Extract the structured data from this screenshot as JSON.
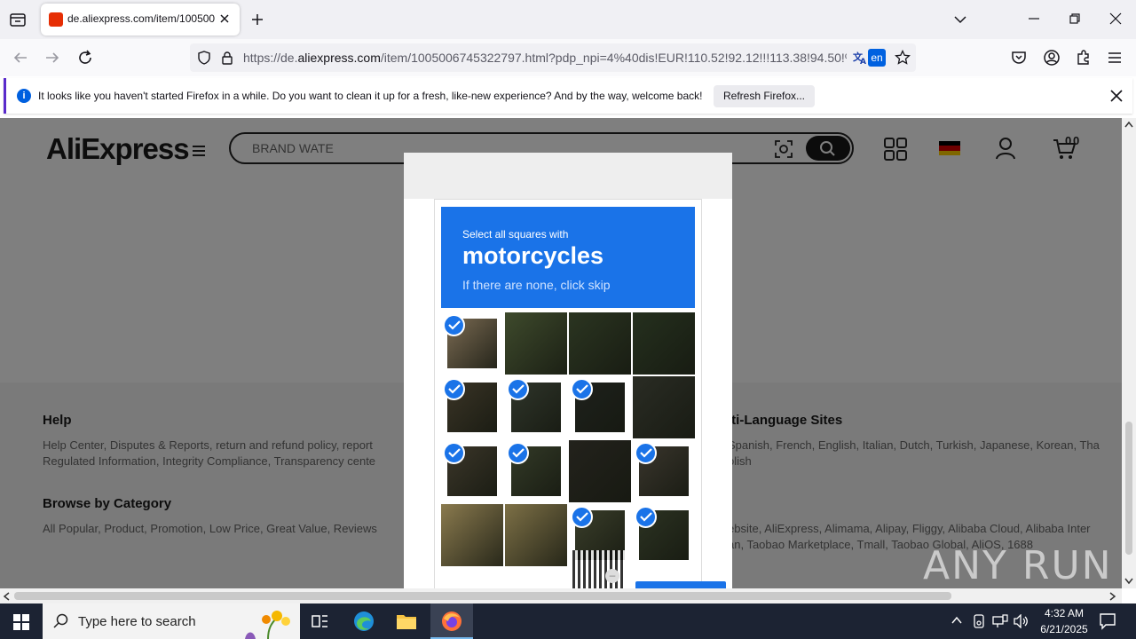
{
  "browser": {
    "tab_title": "de.aliexpress.com/item/100500",
    "url_prefix": "https://de.",
    "url_domain": "aliexpress.com",
    "url_rest": "/item/1005006745322797.html?pdp_npi=4%40dis!EUR!110.52!92.12!!!113.38!94.50!%4",
    "translate_badge": "en"
  },
  "notification": {
    "message": "It looks like you haven't started Firefox in a while. Do you want to clean it up for a fresh, like-new experience? And by the way, welcome back!",
    "button": "Refresh Firefox..."
  },
  "site": {
    "logo": "AliExpress",
    "search_value": "BRAND WATE",
    "cart_count": "0"
  },
  "footer": {
    "help_title": "Help",
    "help_line1": "Help Center, Disputes & Reports, return and refund policy, report",
    "help_line2": "Regulated Information, Integrity Compliance, Transparency cente",
    "multi_title": "lti-Language Sites",
    "multi_line1": "Spanish, French, English, Italian, Dutch, Turkish, Japanese, Korean, Tha",
    "multi_line2": "olish",
    "browse_title": "Browse by Category",
    "browse_line1": "All Popular, Product, Promotion, Low Price, Great Value, Reviews",
    "group_line1": "ebsite, AliExpress, Alimama, Alipay, Fliggy, Alibaba Cloud, Alibaba Inter",
    "group_line2": "an, Taobao Marketplace, Tmall, Taobao Global, AliOS, 1688"
  },
  "captcha": {
    "line1": "Select all squares with",
    "line2": "motorcycles",
    "line3": "If there are none, click skip",
    "tiles": [
      {
        "checked": true,
        "color": "#7a6a52"
      },
      {
        "checked": false,
        "color": "#3e4a2c"
      },
      {
        "checked": false,
        "color": "#2b3521"
      },
      {
        "checked": false,
        "color": "#25301e"
      },
      {
        "checked": true,
        "color": "#3a3426"
      },
      {
        "checked": true,
        "color": "#2f352a"
      },
      {
        "checked": true,
        "color": "#1e211c"
      },
      {
        "checked": false,
        "color": "#2a2c24"
      },
      {
        "checked": true,
        "color": "#3b3629"
      },
      {
        "checked": true,
        "color": "#333a27"
      },
      {
        "checked": false,
        "color": "#23221c"
      },
      {
        "checked": true,
        "color": "#39352c"
      },
      {
        "checked": false,
        "color": "#8a7a4e"
      },
      {
        "checked": false,
        "color": "#7d7046"
      },
      {
        "checked": true,
        "color": "#3a3e2a"
      },
      {
        "checked": true,
        "color": "#2c3322"
      }
    ]
  },
  "watermark": "ANY RUN",
  "taskbar": {
    "search_placeholder": "Type here to search",
    "time": "4:32 AM",
    "date": "6/21/2025"
  }
}
